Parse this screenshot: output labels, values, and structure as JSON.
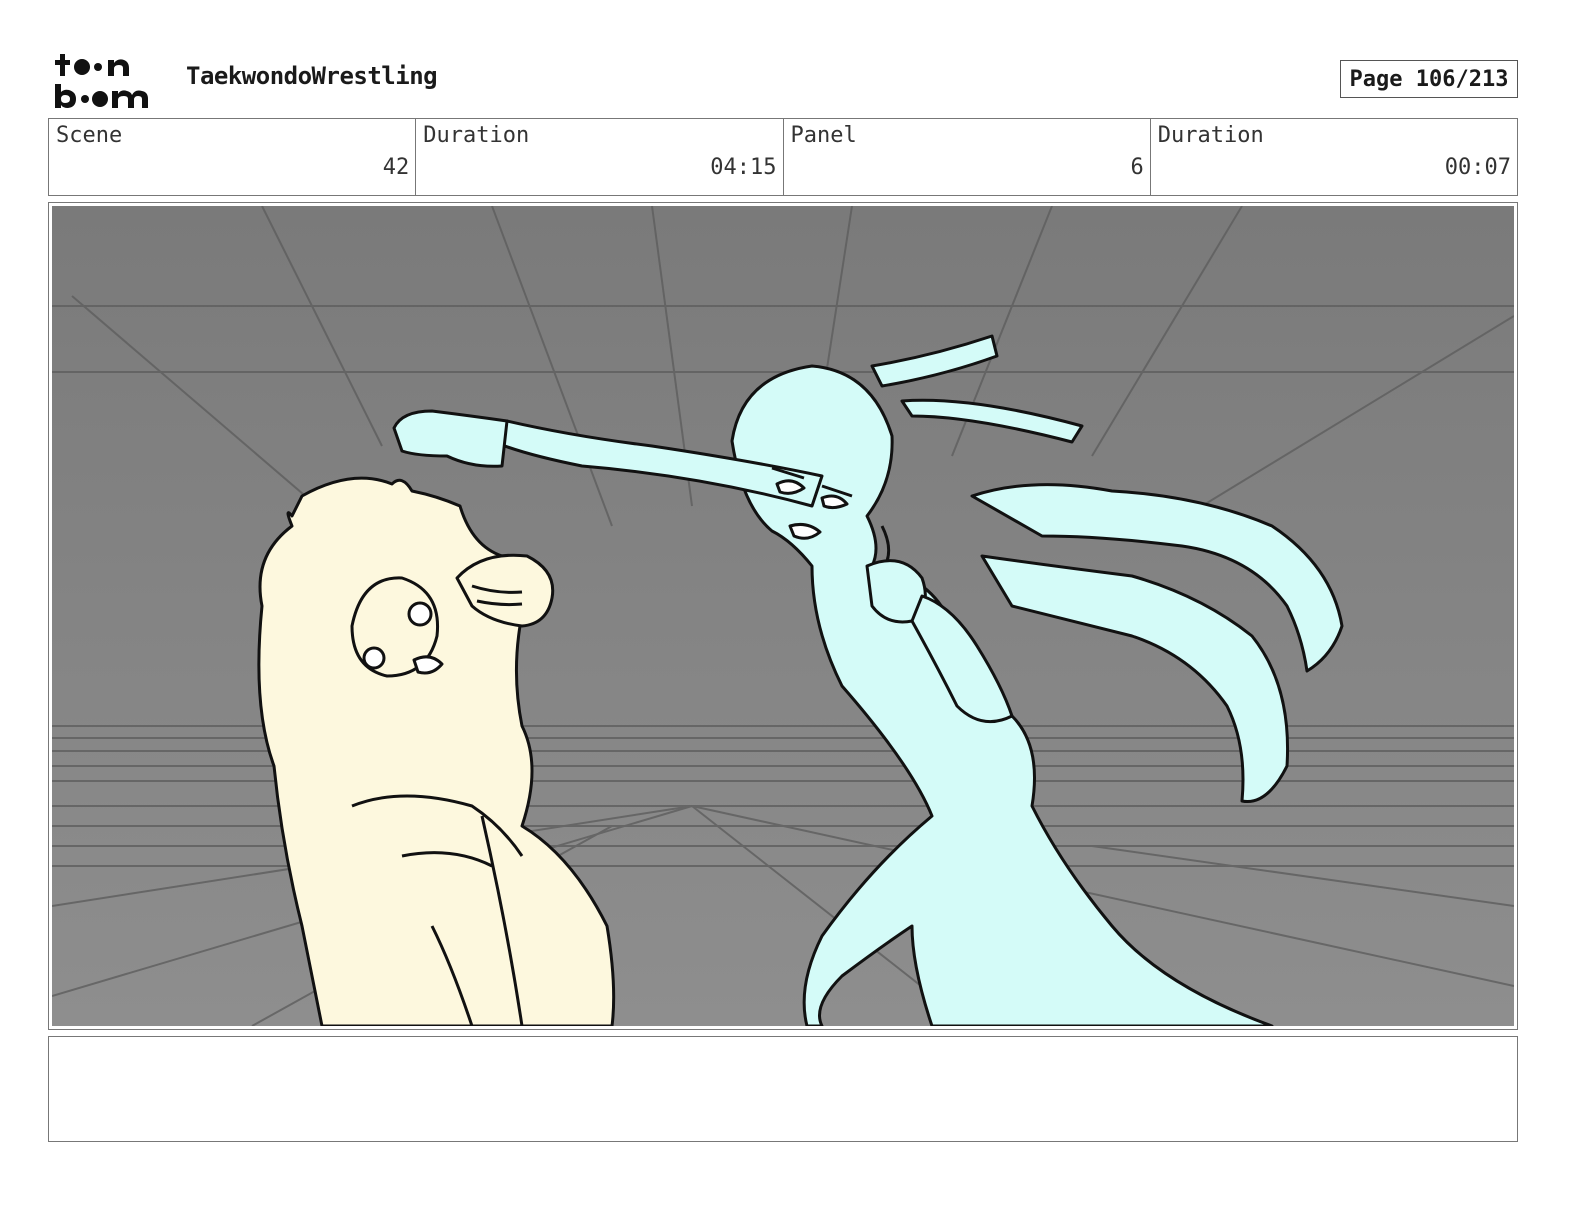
{
  "header": {
    "logo_text": "toon boom",
    "project_title": "TaekwondoWrestling",
    "page_label": "Page 106/213"
  },
  "info": {
    "scene_label": "Scene",
    "scene_value": "42",
    "scene_duration_label": "Duration",
    "scene_duration_value": "04:15",
    "panel_label": "Panel",
    "panel_value": "6",
    "panel_duration_label": "Duration",
    "panel_duration_value": "00:07"
  },
  "panel": {
    "background_color": "#8c8c8c",
    "left_character_color": "#fdf8de",
    "right_character_color": "#d4fbf8"
  },
  "notes": {
    "text": ""
  }
}
